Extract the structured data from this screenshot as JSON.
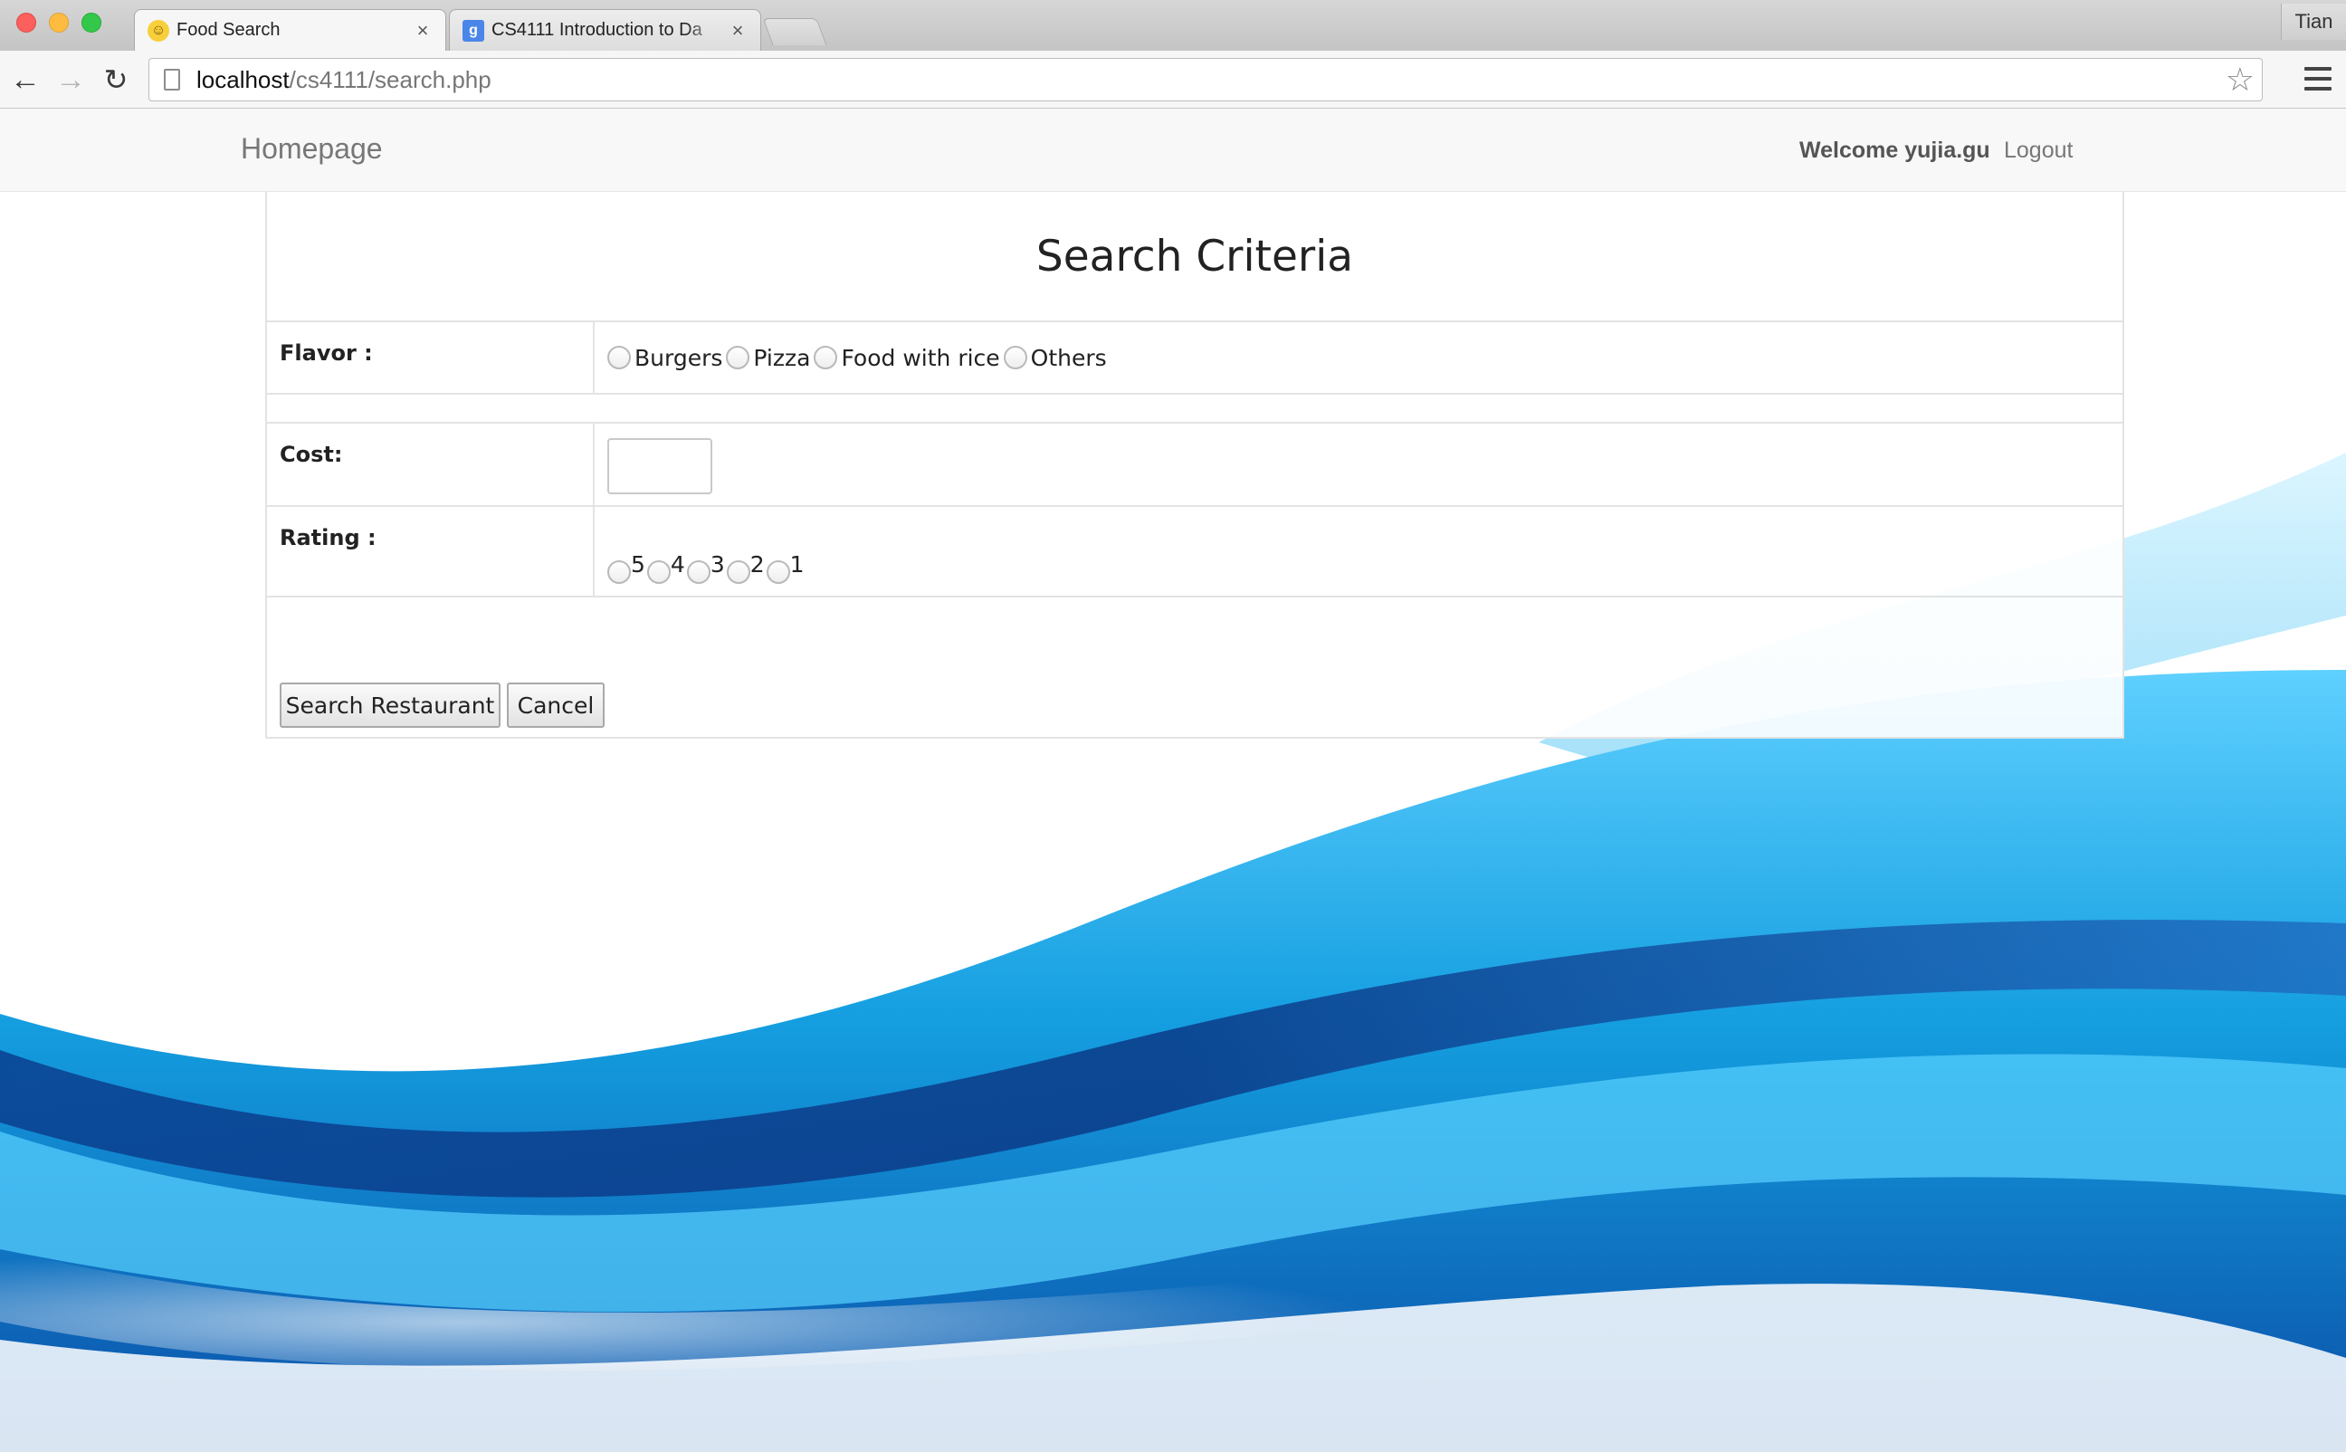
{
  "browser": {
    "tabs": [
      {
        "title": "Food Search",
        "icon": "smiley-favicon-icon",
        "active": true
      },
      {
        "title": "CS4111 Introduction to Da",
        "icon": "google-favicon-icon",
        "active": false
      }
    ],
    "profile_name": "Tian",
    "url_host": "localhost",
    "url_path": "/cs4111/search.php"
  },
  "navbar": {
    "brand": "Homepage",
    "welcome": "Welcome yujia.gu",
    "logout": "Logout"
  },
  "form": {
    "title": "Search Criteria",
    "flavor": {
      "label": "Flavor :",
      "options": [
        "Burgers",
        "Pizza",
        "Food with rice",
        "Others"
      ]
    },
    "cost": {
      "label": "Cost:",
      "value": ""
    },
    "rating": {
      "label": "Rating :",
      "options": [
        "5",
        "4",
        "3",
        "2",
        "1"
      ]
    },
    "buttons": {
      "search": "Search Restaurant",
      "cancel": "Cancel"
    }
  },
  "colors": {
    "wave_primary": "#1ea8e6",
    "wave_dark": "#0a3f8f",
    "wave_light": "#8fe0ff"
  }
}
